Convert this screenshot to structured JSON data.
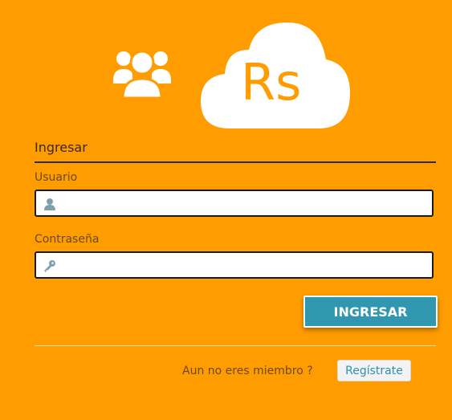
{
  "logo": {
    "brand_text": "Rs",
    "users_icon": "users-group-icon",
    "cloud_icon": "cloud-logo-icon"
  },
  "form": {
    "title": "Ingresar",
    "username_label": "Usuario",
    "username_value": "",
    "username_icon": "user-icon",
    "password_label": "Contraseña",
    "password_value": "",
    "password_icon": "key-icon",
    "submit_label": "INGRESAR"
  },
  "footer": {
    "member_text": "Aun no eres miembro ?",
    "register_label": "Regístrate"
  },
  "colors": {
    "background": "#ff9c00",
    "primary_button": "#3197b0",
    "link": "#2f8fb0"
  }
}
